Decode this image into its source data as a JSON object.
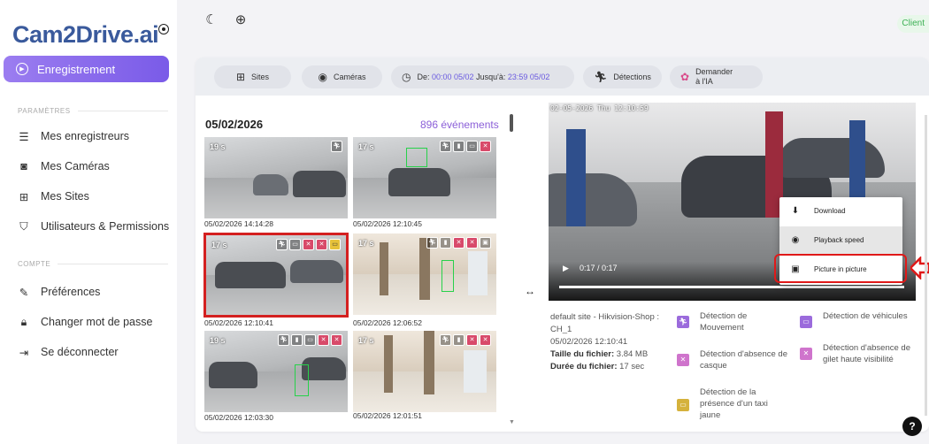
{
  "app": {
    "logo_text": "Cam2Drive.ai",
    "client_badge": "Client"
  },
  "sidebar": {
    "active_item": "Enregistrement",
    "section_params": "PARAMÈTRES",
    "items_params": [
      "Mes enregistreurs",
      "Mes Caméras",
      "Mes Sites",
      "Utilisateurs & Permissions"
    ],
    "section_account": "COMPTE",
    "items_account": [
      "Préférences",
      "Changer mot de passe",
      "Se déconnecter"
    ]
  },
  "filters": {
    "sites": "Sites",
    "cameras": "Caméras",
    "date_from_label": "De:",
    "date_from": "00:00 05/02",
    "date_to_label": "Jusqu'à:",
    "date_to": "23:59 05/02",
    "detections": "Détections",
    "ask_ai_line1": "Demander",
    "ask_ai_line2": "à l'IA"
  },
  "events": {
    "date": "05/02/2026",
    "count": "896 événements",
    "items": [
      {
        "duration": "19 s",
        "timestamp": "05/02/2026 14:14:28"
      },
      {
        "duration": "17 s",
        "timestamp": "05/02/2026 12:10:45"
      },
      {
        "duration": "17 s",
        "timestamp": "05/02/2026 12:10:41"
      },
      {
        "duration": "17 s",
        "timestamp": "05/02/2026 12:06:52"
      },
      {
        "duration": "19 s",
        "timestamp": "05/02/2026 12:03:30"
      },
      {
        "duration": "17 s",
        "timestamp": "05/02/2026 12:01:51"
      }
    ]
  },
  "player": {
    "overlay_timestamp": "02-05-2026 Thu 12:10:59",
    "current_time": "0:17 / 0:17",
    "progress": 1.0,
    "menu": [
      "Download",
      "Playback speed",
      "Picture in picture"
    ]
  },
  "details": {
    "source": "default site - Hikvision-Shop : CH_1",
    "datetime": "05/02/2026 12:10:41",
    "size_label": "Taille du fichier:",
    "size_value": "3.84 MB",
    "duration_label": "Durée du fichier:",
    "duration_value": "17 sec",
    "detections": [
      "Détection de Mouvement",
      "Détection de véhicules",
      "Détection d'absence de casque",
      "Détection d'absence de gilet haute visibilité",
      "Détection de la présence d'un taxi jaune"
    ]
  },
  "colors": {
    "accent": "#7a5be8",
    "highlight": "#e01919",
    "detection_box": "#27d14a"
  }
}
